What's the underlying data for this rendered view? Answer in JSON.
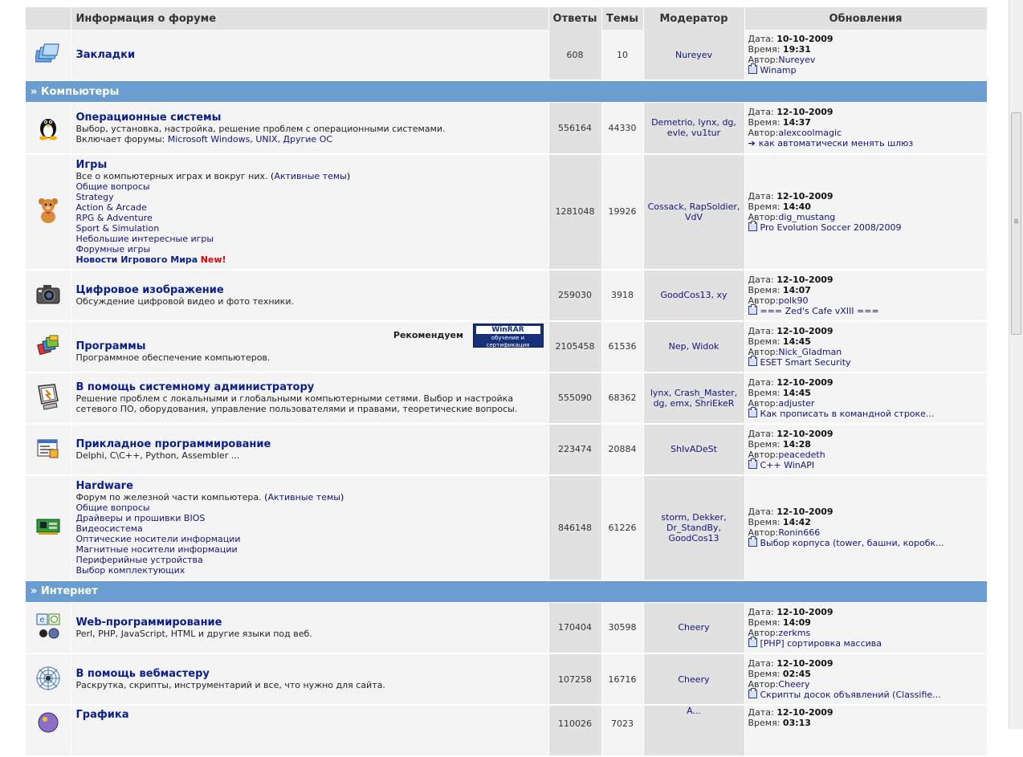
{
  "colors": {
    "category_bar": "#6a9ed0",
    "header_bg": "#e1e1e1",
    "row_bg": "#f4f4f4",
    "forum_link": "#0b1e8c",
    "new_badge": "#e00000"
  },
  "header": {
    "info": "Информация о форуме",
    "replies": "Ответы",
    "topics": "Темы",
    "moderator": "Модератор",
    "updates": "Обновления"
  },
  "labels": {
    "date": "Дата:",
    "time": "Время:",
    "author": "Автор:",
    "recommend": "Рекомендуем",
    "new": "New!"
  },
  "winrar": {
    "brand": "WinRAR",
    "tagline": "обучение и сертификация"
  },
  "categories": [
    {
      "name": "» Компьютеры"
    },
    {
      "name": "» Интернет"
    }
  ],
  "forums": [
    {
      "icon": "bookmarks-icon",
      "name": "Закладки",
      "desc": "",
      "replies": "608",
      "topics": "10",
      "moderator": "Nureyev",
      "last": {
        "date": "10-10-2009",
        "time": "19:31",
        "author": "Nureyev",
        "topic": "Winamp"
      }
    },
    {
      "icon": "linux-penguin-icon",
      "name": "Операционные системы",
      "desc": "Выбор, установка, настройка, решение проблем с операционными системами.",
      "includes_label": "Включает форумы:",
      "includes": "Microsoft Windows, UNIX, Другие ОС",
      "replies": "556164",
      "topics": "44330",
      "moderator": "Demetrio, lynx, dg, evle, vu1tur",
      "last": {
        "date": "12-10-2009",
        "time": "14:37",
        "author": "alexcoolmagic",
        "topic": "как автоматически менять шлюз"
      }
    },
    {
      "icon": "teddy-bear-icon",
      "name": "Игры",
      "desc": "Все о компьютерных играх и вокруг них.",
      "active_topics": "Активные темы",
      "subforums": [
        "Общие вопросы",
        "Strategy",
        "Action & Arcade",
        "RPG & Adventure",
        "Sport & Simulation",
        "Небольшие интересные игры",
        "Форумные игры"
      ],
      "news": "Новости Игрового Мира",
      "replies": "1281048",
      "topics": "19926",
      "moderator": "Cossack, RapSoldier, VdV",
      "last": {
        "date": "12-10-2009",
        "time": "14:40",
        "author": "dig_mustang",
        "topic": "Pro Evolution Soccer 2008/2009"
      }
    },
    {
      "icon": "camera-icon",
      "name": "Цифровое изображение",
      "desc": "Обсуждение цифровой видео и фото техники.",
      "replies": "259030",
      "topics": "3918",
      "moderator": "GoodCos13, xy",
      "last": {
        "date": "12-10-2009",
        "time": "14:07",
        "author": "polk90",
        "topic": "=== Zed's Cafe vXIII ==="
      }
    },
    {
      "icon": "software-books-icon",
      "name": "Программы",
      "desc": "Программное обеспечение компьютеров.",
      "replies": "2105458",
      "topics": "61536",
      "moderator": "Nep, Widok",
      "last": {
        "date": "12-10-2009",
        "time": "14:45",
        "author": "Nick_Gladman",
        "topic": "ESET Smart Security"
      }
    },
    {
      "icon": "admin-monitor-icon",
      "name": "В помощь системному администратору",
      "desc": "Решение проблем с локальными и глобальными компьютерными сетями. Выбор и настройка сетевого ПО, оборудования, управление пользователями и правами, теоретические вопросы.",
      "replies": "555090",
      "topics": "68362",
      "moderator": "lynx, Crash_Master, dg, emx, ShriEkeR",
      "last": {
        "date": "12-10-2009",
        "time": "14:45",
        "author": "adjuster",
        "topic": "Как прописать в командной строке..."
      }
    },
    {
      "icon": "code-window-icon",
      "name": "Прикладное программирование",
      "desc": "Delphi, C\\C++, Python, Assembler ...",
      "replies": "223474",
      "topics": "20884",
      "moderator": "ShIvADeSt",
      "last": {
        "date": "12-10-2009",
        "time": "14:28",
        "author": "peacedeth",
        "topic": "C++ WinAPI"
      }
    },
    {
      "icon": "circuit-board-icon",
      "name": "Hardware",
      "desc": "Форум по железной части компьютера.",
      "active_topics": "Активные темы",
      "subforums": [
        "Общие вопросы",
        "Драйверы и прошивки BIOS",
        "Видеосистема",
        "Оптические носители информации",
        "Магнитные носители информации",
        "Периферийные устройства",
        "Выбор комплектующих"
      ],
      "replies": "846148",
      "topics": "61226",
      "moderator": "storm, Dekker, Dr_StandBy, GoodCos13",
      "last": {
        "date": "12-10-2009",
        "time": "14:42",
        "author": "Ronin666",
        "topic": "Выбор корпуса (tower, башни, коробк..."
      }
    },
    {
      "icon": "web-globe-icon",
      "name": "Web-программирование",
      "desc": "Perl, PHP, JavaScript, HTML и другие языки под веб.",
      "replies": "170404",
      "topics": "30598",
      "moderator": "Cheery",
      "last": {
        "date": "12-10-2009",
        "time": "14:09",
        "author": "zerkms",
        "topic": "[PHP] сортировка массива"
      }
    },
    {
      "icon": "spider-web-icon",
      "name": "В помощь вебмастеру",
      "desc": "Раскрутка, скрипты, инструментарий и все, что нужно для сайта.",
      "replies": "107258",
      "topics": "16716",
      "moderator": "Cheery",
      "last": {
        "date": "12-10-2009",
        "time": "02:45",
        "author": "Cheery",
        "topic": "Скрипты досок объявлений (Classifie..."
      }
    },
    {
      "icon": "graphics-icon",
      "name": "Графика",
      "desc": "",
      "replies": "110026",
      "topics": "7023",
      "moderator": "A...",
      "last": {
        "date": "12-10-2009",
        "time": "03:13",
        "author": "",
        "topic": ""
      }
    }
  ]
}
